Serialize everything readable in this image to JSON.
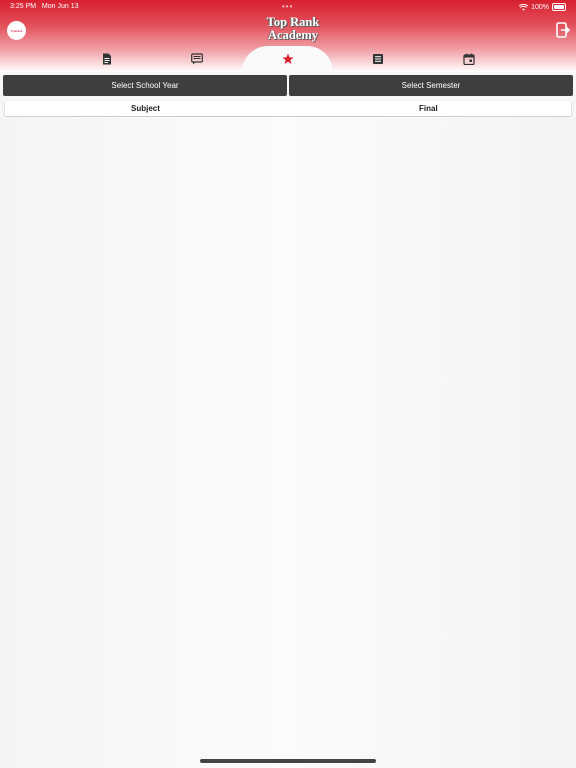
{
  "status": {
    "time": "3:25 PM",
    "date": "Mon Jun 13",
    "battery": "100%"
  },
  "app": {
    "title_line1": "Top Rank",
    "title_line2": "Academy"
  },
  "tabs": [
    {
      "icon": "document-icon",
      "active": false
    },
    {
      "icon": "message-icon",
      "active": false
    },
    {
      "icon": "star-icon",
      "active": true
    },
    {
      "icon": "list-icon",
      "active": false
    },
    {
      "icon": "calendar-icon",
      "active": false
    }
  ],
  "filters": {
    "school_year": "Select School Year",
    "semester": "Select Semester"
  },
  "table": {
    "columns": [
      "Subject",
      "Final"
    ]
  },
  "colors": {
    "brand": "#d8202f",
    "bar": "#3e3e3e",
    "active_icon": "#d8202f"
  }
}
